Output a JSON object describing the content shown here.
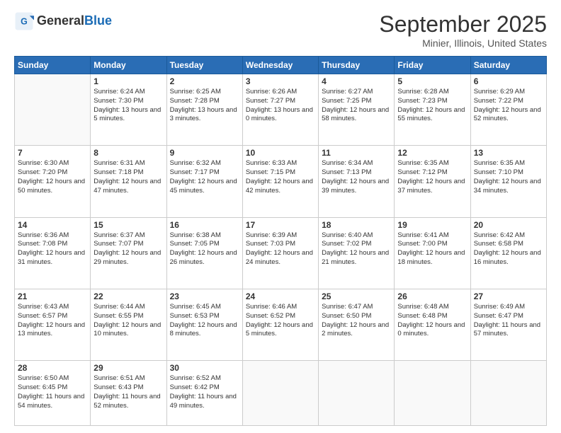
{
  "logo": {
    "general": "General",
    "blue": "Blue"
  },
  "header": {
    "month": "September 2025",
    "location": "Minier, Illinois, United States"
  },
  "weekdays": [
    "Sunday",
    "Monday",
    "Tuesday",
    "Wednesday",
    "Thursday",
    "Friday",
    "Saturday"
  ],
  "weeks": [
    [
      {
        "day": "",
        "info": ""
      },
      {
        "day": "1",
        "info": "Sunrise: 6:24 AM\nSunset: 7:30 PM\nDaylight: 13 hours\nand 5 minutes."
      },
      {
        "day": "2",
        "info": "Sunrise: 6:25 AM\nSunset: 7:28 PM\nDaylight: 13 hours\nand 3 minutes."
      },
      {
        "day": "3",
        "info": "Sunrise: 6:26 AM\nSunset: 7:27 PM\nDaylight: 13 hours\nand 0 minutes."
      },
      {
        "day": "4",
        "info": "Sunrise: 6:27 AM\nSunset: 7:25 PM\nDaylight: 12 hours\nand 58 minutes."
      },
      {
        "day": "5",
        "info": "Sunrise: 6:28 AM\nSunset: 7:23 PM\nDaylight: 12 hours\nand 55 minutes."
      },
      {
        "day": "6",
        "info": "Sunrise: 6:29 AM\nSunset: 7:22 PM\nDaylight: 12 hours\nand 52 minutes."
      }
    ],
    [
      {
        "day": "7",
        "info": "Sunrise: 6:30 AM\nSunset: 7:20 PM\nDaylight: 12 hours\nand 50 minutes."
      },
      {
        "day": "8",
        "info": "Sunrise: 6:31 AM\nSunset: 7:18 PM\nDaylight: 12 hours\nand 47 minutes."
      },
      {
        "day": "9",
        "info": "Sunrise: 6:32 AM\nSunset: 7:17 PM\nDaylight: 12 hours\nand 45 minutes."
      },
      {
        "day": "10",
        "info": "Sunrise: 6:33 AM\nSunset: 7:15 PM\nDaylight: 12 hours\nand 42 minutes."
      },
      {
        "day": "11",
        "info": "Sunrise: 6:34 AM\nSunset: 7:13 PM\nDaylight: 12 hours\nand 39 minutes."
      },
      {
        "day": "12",
        "info": "Sunrise: 6:35 AM\nSunset: 7:12 PM\nDaylight: 12 hours\nand 37 minutes."
      },
      {
        "day": "13",
        "info": "Sunrise: 6:35 AM\nSunset: 7:10 PM\nDaylight: 12 hours\nand 34 minutes."
      }
    ],
    [
      {
        "day": "14",
        "info": "Sunrise: 6:36 AM\nSunset: 7:08 PM\nDaylight: 12 hours\nand 31 minutes."
      },
      {
        "day": "15",
        "info": "Sunrise: 6:37 AM\nSunset: 7:07 PM\nDaylight: 12 hours\nand 29 minutes."
      },
      {
        "day": "16",
        "info": "Sunrise: 6:38 AM\nSunset: 7:05 PM\nDaylight: 12 hours\nand 26 minutes."
      },
      {
        "day": "17",
        "info": "Sunrise: 6:39 AM\nSunset: 7:03 PM\nDaylight: 12 hours\nand 24 minutes."
      },
      {
        "day": "18",
        "info": "Sunrise: 6:40 AM\nSunset: 7:02 PM\nDaylight: 12 hours\nand 21 minutes."
      },
      {
        "day": "19",
        "info": "Sunrise: 6:41 AM\nSunset: 7:00 PM\nDaylight: 12 hours\nand 18 minutes."
      },
      {
        "day": "20",
        "info": "Sunrise: 6:42 AM\nSunset: 6:58 PM\nDaylight: 12 hours\nand 16 minutes."
      }
    ],
    [
      {
        "day": "21",
        "info": "Sunrise: 6:43 AM\nSunset: 6:57 PM\nDaylight: 12 hours\nand 13 minutes."
      },
      {
        "day": "22",
        "info": "Sunrise: 6:44 AM\nSunset: 6:55 PM\nDaylight: 12 hours\nand 10 minutes."
      },
      {
        "day": "23",
        "info": "Sunrise: 6:45 AM\nSunset: 6:53 PM\nDaylight: 12 hours\nand 8 minutes."
      },
      {
        "day": "24",
        "info": "Sunrise: 6:46 AM\nSunset: 6:52 PM\nDaylight: 12 hours\nand 5 minutes."
      },
      {
        "day": "25",
        "info": "Sunrise: 6:47 AM\nSunset: 6:50 PM\nDaylight: 12 hours\nand 2 minutes."
      },
      {
        "day": "26",
        "info": "Sunrise: 6:48 AM\nSunset: 6:48 PM\nDaylight: 12 hours\nand 0 minutes."
      },
      {
        "day": "27",
        "info": "Sunrise: 6:49 AM\nSunset: 6:47 PM\nDaylight: 11 hours\nand 57 minutes."
      }
    ],
    [
      {
        "day": "28",
        "info": "Sunrise: 6:50 AM\nSunset: 6:45 PM\nDaylight: 11 hours\nand 54 minutes."
      },
      {
        "day": "29",
        "info": "Sunrise: 6:51 AM\nSunset: 6:43 PM\nDaylight: 11 hours\nand 52 minutes."
      },
      {
        "day": "30",
        "info": "Sunrise: 6:52 AM\nSunset: 6:42 PM\nDaylight: 11 hours\nand 49 minutes."
      },
      {
        "day": "",
        "info": ""
      },
      {
        "day": "",
        "info": ""
      },
      {
        "day": "",
        "info": ""
      },
      {
        "day": "",
        "info": ""
      }
    ]
  ]
}
